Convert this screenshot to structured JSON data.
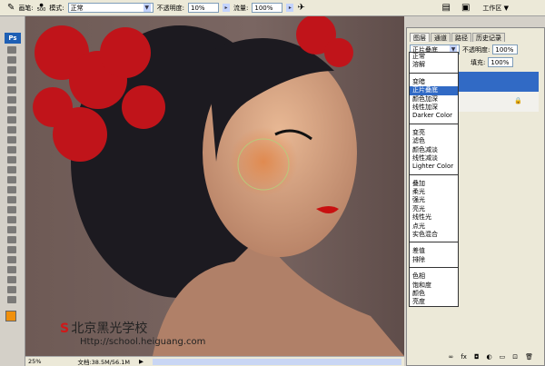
{
  "options_bar": {
    "brush_label": "画笔:",
    "brush_size": "500",
    "mode_label": "模式:",
    "mode_value": "正常",
    "opacity_label": "不透明度:",
    "opacity_value": "10%",
    "flow_label": "流量:",
    "flow_value": "100%",
    "workspace_label": "工作区 ▼"
  },
  "tools": {
    "ps_logo": "Ps",
    "foreground_color": "#f0900c"
  },
  "canvas": {
    "watermark_cn": "北京黑光学校",
    "watermark_url": "Http://school.heiguang.com"
  },
  "status": {
    "zoom": "25%",
    "doc_info": "文档:38.5M/56.1M"
  },
  "layers_panel": {
    "tabs": [
      "图层",
      "通道",
      "路径",
      "历史记录"
    ],
    "blend_mode": "正片叠底",
    "opacity_label": "不透明度:",
    "opacity_value": "100%",
    "fill_label": "填充:",
    "fill_value": "100%",
    "selected_color": "#316ac5"
  },
  "blend_list": {
    "groups": [
      [
        "正常",
        "溶解"
      ],
      [
        "变暗",
        "正片叠底",
        "颜色加深",
        "线性加深",
        "Darker Color"
      ],
      [
        "变亮",
        "滤色",
        "颜色减淡",
        "线性减淡",
        "Lighter Color"
      ],
      [
        "叠加",
        "柔光",
        "强光",
        "亮光",
        "线性光",
        "点光",
        "实色混合"
      ],
      [
        "差值",
        "排除"
      ],
      [
        "色相",
        "饱和度",
        "颜色",
        "亮度"
      ]
    ],
    "selected": "正片叠底"
  }
}
